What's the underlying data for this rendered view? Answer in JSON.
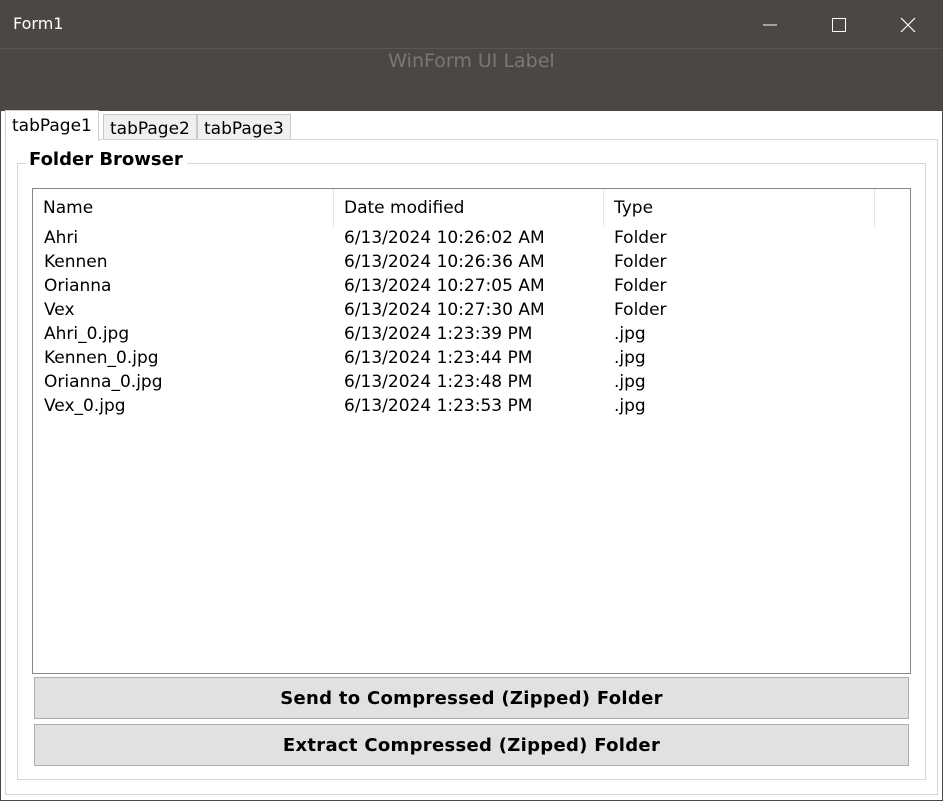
{
  "window": {
    "title": "Form1",
    "controls": [
      "minimize-icon",
      "maximize-icon",
      "close-icon"
    ]
  },
  "header": {
    "label": "WinForm UI Label"
  },
  "tabs": [
    {
      "label": "tabPage1",
      "active": true
    },
    {
      "label": "tabPage2",
      "active": false
    },
    {
      "label": "tabPage3",
      "active": false
    }
  ],
  "group": {
    "title": "Folder Browser"
  },
  "list": {
    "columns": [
      "Name",
      "Date modified",
      "Type"
    ],
    "rows": [
      {
        "name": "Ahri",
        "date": "6/13/2024 10:26:02 AM",
        "type": "Folder"
      },
      {
        "name": "Kennen",
        "date": "6/13/2024 10:26:36 AM",
        "type": "Folder"
      },
      {
        "name": "Orianna",
        "date": "6/13/2024 10:27:05 AM",
        "type": "Folder"
      },
      {
        "name": "Vex",
        "date": "6/13/2024 10:27:30 AM",
        "type": "Folder"
      },
      {
        "name": "Ahri_0.jpg",
        "date": "6/13/2024 1:23:39 PM",
        "type": ".jpg"
      },
      {
        "name": "Kennen_0.jpg",
        "date": "6/13/2024 1:23:44 PM",
        "type": ".jpg"
      },
      {
        "name": "Orianna_0.jpg",
        "date": "6/13/2024 1:23:48 PM",
        "type": ".jpg"
      },
      {
        "name": "Vex_0.jpg",
        "date": "6/13/2024 1:23:53 PM",
        "type": ".jpg"
      }
    ]
  },
  "buttons": {
    "send": "Send to Compressed (Zipped) Folder",
    "extract": "Extract Compressed (Zipped) Folder"
  },
  "colors": {
    "titlebar": "#4b4743",
    "header_label": "#7b7874",
    "button_face": "#e1e1e1",
    "list_border": "#828790"
  }
}
